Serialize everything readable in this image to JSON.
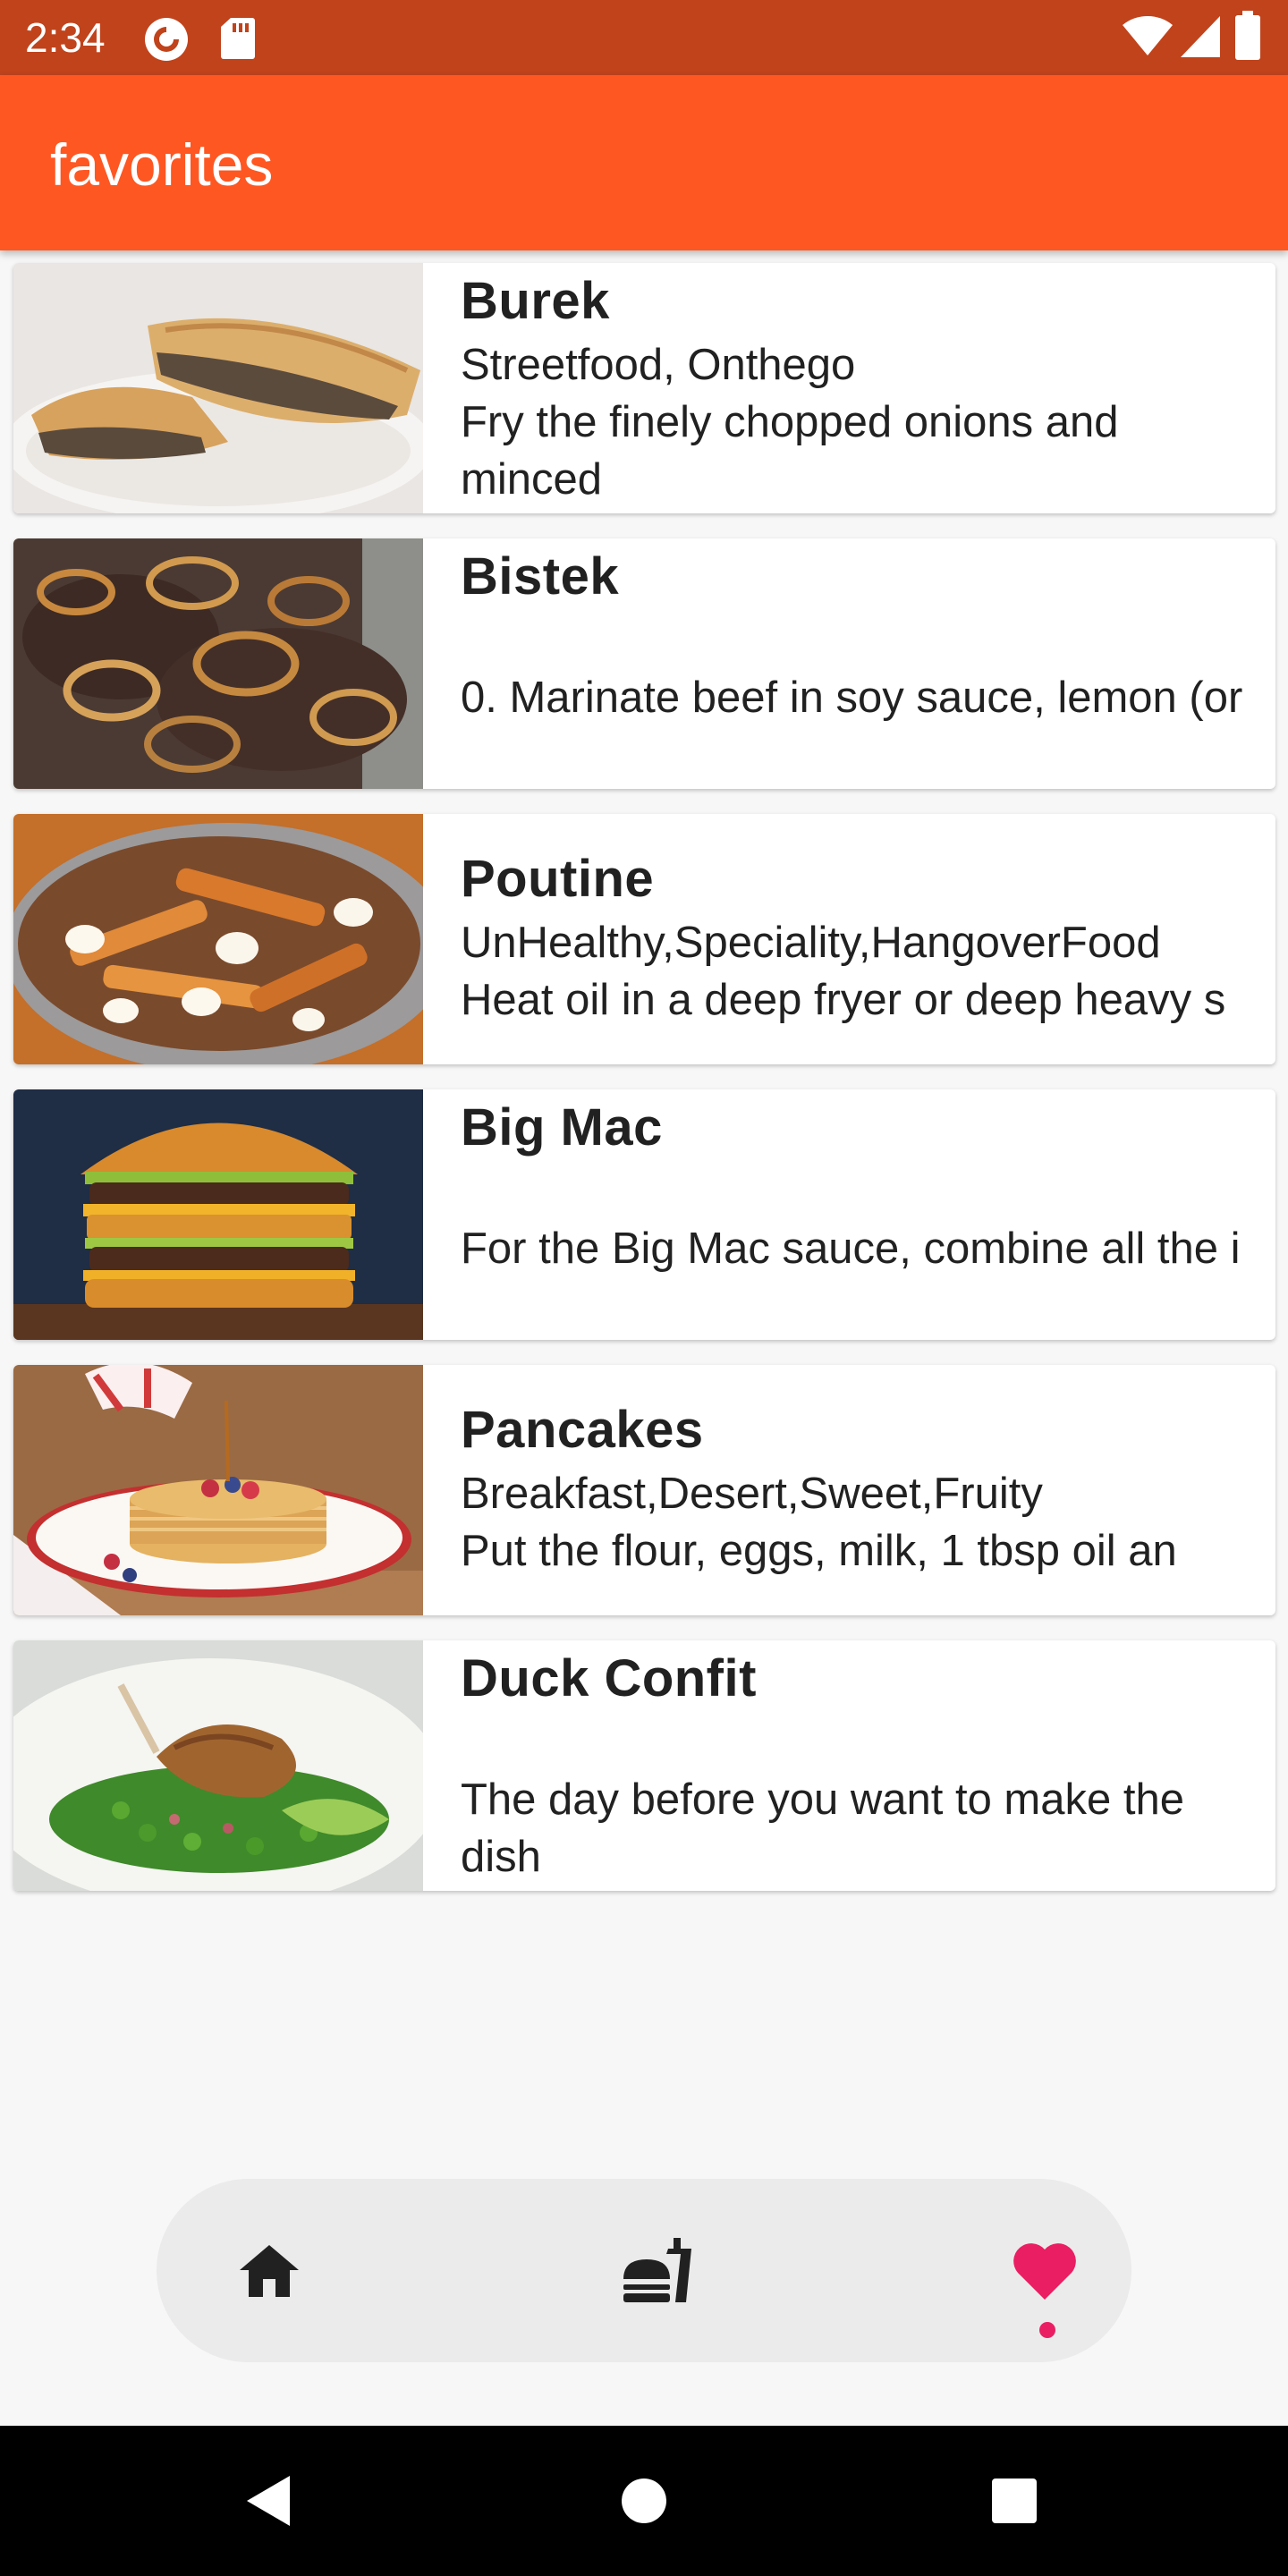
{
  "status_bar": {
    "time": "2:34",
    "left_icons": [
      "pocket-casts-icon",
      "sd-card-icon"
    ],
    "right_icons": [
      "wifi-icon",
      "cell-signal-icon",
      "battery-icon"
    ]
  },
  "app_bar": {
    "title": "favorites",
    "color": "#fe5722"
  },
  "recipes": [
    {
      "title": "Burek",
      "tags": "Streetfood, Onthego",
      "description": "Fry the finely chopped onions and minced",
      "image": "burek-photo"
    },
    {
      "title": "Bistek",
      "tags": "",
      "description": "0. Marinate beef in soy sauce, lemon (or",
      "image": "bistek-photo"
    },
    {
      "title": "Poutine",
      "tags": "UnHealthy,Speciality,HangoverFood",
      "description": "Heat oil in a deep fryer or deep heavy s",
      "image": "poutine-photo"
    },
    {
      "title": "Big Mac",
      "tags": "",
      "description": "For the Big Mac sauce, combine all the i",
      "image": "big-mac-photo"
    },
    {
      "title": "Pancakes",
      "tags": "Breakfast,Desert,Sweet,Fruity",
      "description": "Put the flour, eggs, milk, 1 tbsp oil an",
      "image": "pancakes-photo"
    },
    {
      "title": "Duck Confit",
      "tags": "",
      "description": "The day before you want to make the dish",
      "image": "duck-confit-photo"
    }
  ],
  "bottom_nav": {
    "items": [
      {
        "name": "home",
        "icon": "home-icon"
      },
      {
        "name": "meals",
        "icon": "fastfood-icon"
      },
      {
        "name": "favorites",
        "icon": "heart-icon",
        "active": true
      }
    ],
    "active_color": "#e91e63"
  },
  "system_nav": {
    "icons": [
      "back-icon",
      "home-circle-icon",
      "recents-icon"
    ]
  }
}
